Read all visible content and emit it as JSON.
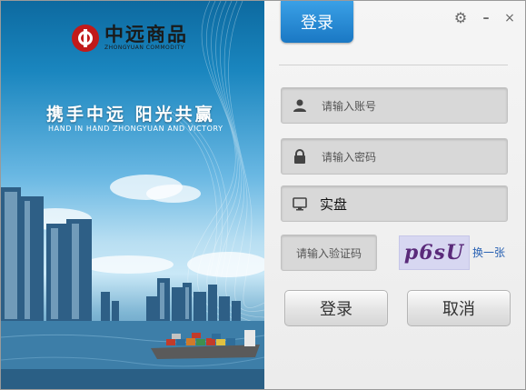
{
  "banner": {
    "logo_text": "中远商品",
    "logo_subtext": "ZHONGYUAN COMMODITY",
    "slogan_cn": "携手中远  阳光共赢",
    "slogan_en": "HAND IN HAND ZHONGYUAN  AND  VICTORY"
  },
  "header": {
    "login_tab": "登录",
    "settings_icon": "gear-icon",
    "minimize_label": "–",
    "close_label": "×"
  },
  "form": {
    "account_placeholder": "请输入账号",
    "password_placeholder": "请输入密码",
    "mode_value": "实盘",
    "captcha_placeholder": "请输入验证码",
    "captcha_image_text": "p6sU",
    "refresh_captcha": "换一张"
  },
  "buttons": {
    "login": "登录",
    "cancel": "取消"
  },
  "colors": {
    "accent": "#1a78c4",
    "logo_red": "#c11a1a",
    "link": "#2a62b3"
  }
}
